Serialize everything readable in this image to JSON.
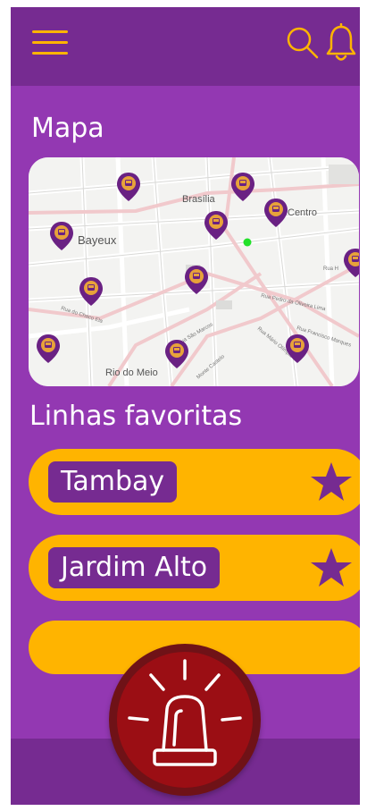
{
  "header": {
    "menu_icon": "hamburger-menu-icon",
    "search_icon": "search-icon",
    "notification_icon": "bell-icon",
    "accent_color": "#ffb400",
    "bar_color": "#762b91"
  },
  "map": {
    "title": "Mapa",
    "labels": {
      "brasilia": "Brasília",
      "centro": "Centro",
      "bayeux": "Bayeux",
      "rio_do_meio": "Rio do Meio",
      "rua_chaco": "Rua do Chaco Ela",
      "rua_pedro": "Rua Pedro da Oliveira Lima",
      "rua_sao_marcos": "Rua São Marcos",
      "rua_francisco": "Rua Francisco Marques",
      "rua_mario": "Rua Mário Olímpio",
      "rua_h": "Rua H",
      "monte_castelo": "Monte Castelo"
    },
    "pin_icon": "bus-stop-pin-icon",
    "user_location_icon": "current-location-dot-icon"
  },
  "favorites": {
    "title": "Linhas favoritas",
    "items": [
      {
        "label": "Tambay",
        "icon": "star-icon"
      },
      {
        "label": "Jardim Alto",
        "icon": "star-icon"
      }
    ]
  },
  "emergency": {
    "icon": "emergency-siren-icon",
    "color": "#9b0e14"
  },
  "colors": {
    "background": "#9338b2",
    "row": "#ffb400",
    "label_bg": "#762b91"
  }
}
